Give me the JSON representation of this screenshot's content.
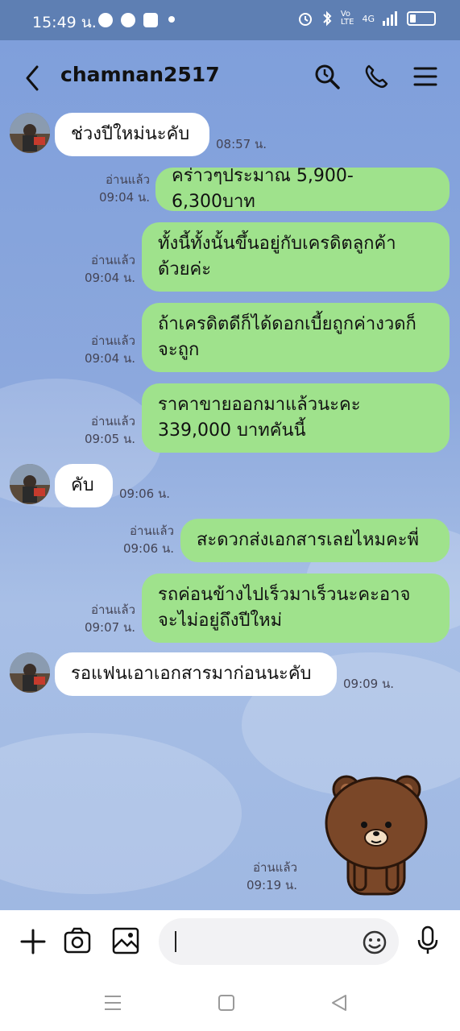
{
  "status_bar": {
    "time": "15:49 น.",
    "network": "4G"
  },
  "header": {
    "title": "chamnan2517"
  },
  "messages": [
    {
      "text": "ช่วงปีใหม่นะคับ",
      "time": "08:57 น."
    },
    {
      "read": "อ่านแล้ว",
      "time": "09:04 น.",
      "text": "คร่าวๆประมาณ 5,900-6,300บาท"
    },
    {
      "read": "อ่านแล้ว",
      "time": "09:04 น.",
      "line1": "ทั้งนี้ทั้งนั้นขึ้นอยู่กับเครดิตลูกค้า",
      "line2": "ด้วยค่ะ"
    },
    {
      "read": "อ่านแล้ว",
      "time": "09:04 น.",
      "line1": "ถ้าเครดิตดีก็ได้ดอกเบี้ยถูกค่างวดก็",
      "line2": "จะถูก"
    },
    {
      "read": "อ่านแล้ว",
      "time": "09:05 น.",
      "line1": "ราคาขายออกมาแล้วนะคะ",
      "line2": "339,000 บาทคันนี้"
    },
    {
      "text": "คับ",
      "time": "09:06 น."
    },
    {
      "read": "อ่านแล้ว",
      "time": "09:06 น.",
      "text": "สะดวกส่งเอกสารเลยไหมคะพี่"
    },
    {
      "read": "อ่านแล้ว",
      "time": "09:07 น.",
      "line1": "รถค่อนข้างไปเร็วมาเร็วนะคะอาจ",
      "line2": "จะไม่อยู่ถึงปีใหม่"
    },
    {
      "text": "รอแฟนเอาเอกสารมาก่อนนะคับ",
      "time": "09:09 น."
    },
    {
      "read": "อ่านแล้ว",
      "time": "09:19 น."
    }
  ],
  "colors": {
    "outgoing_bubble": "#9fe28c",
    "incoming_bubble": "#ffffff",
    "status_bar": "#5e7fb3"
  }
}
